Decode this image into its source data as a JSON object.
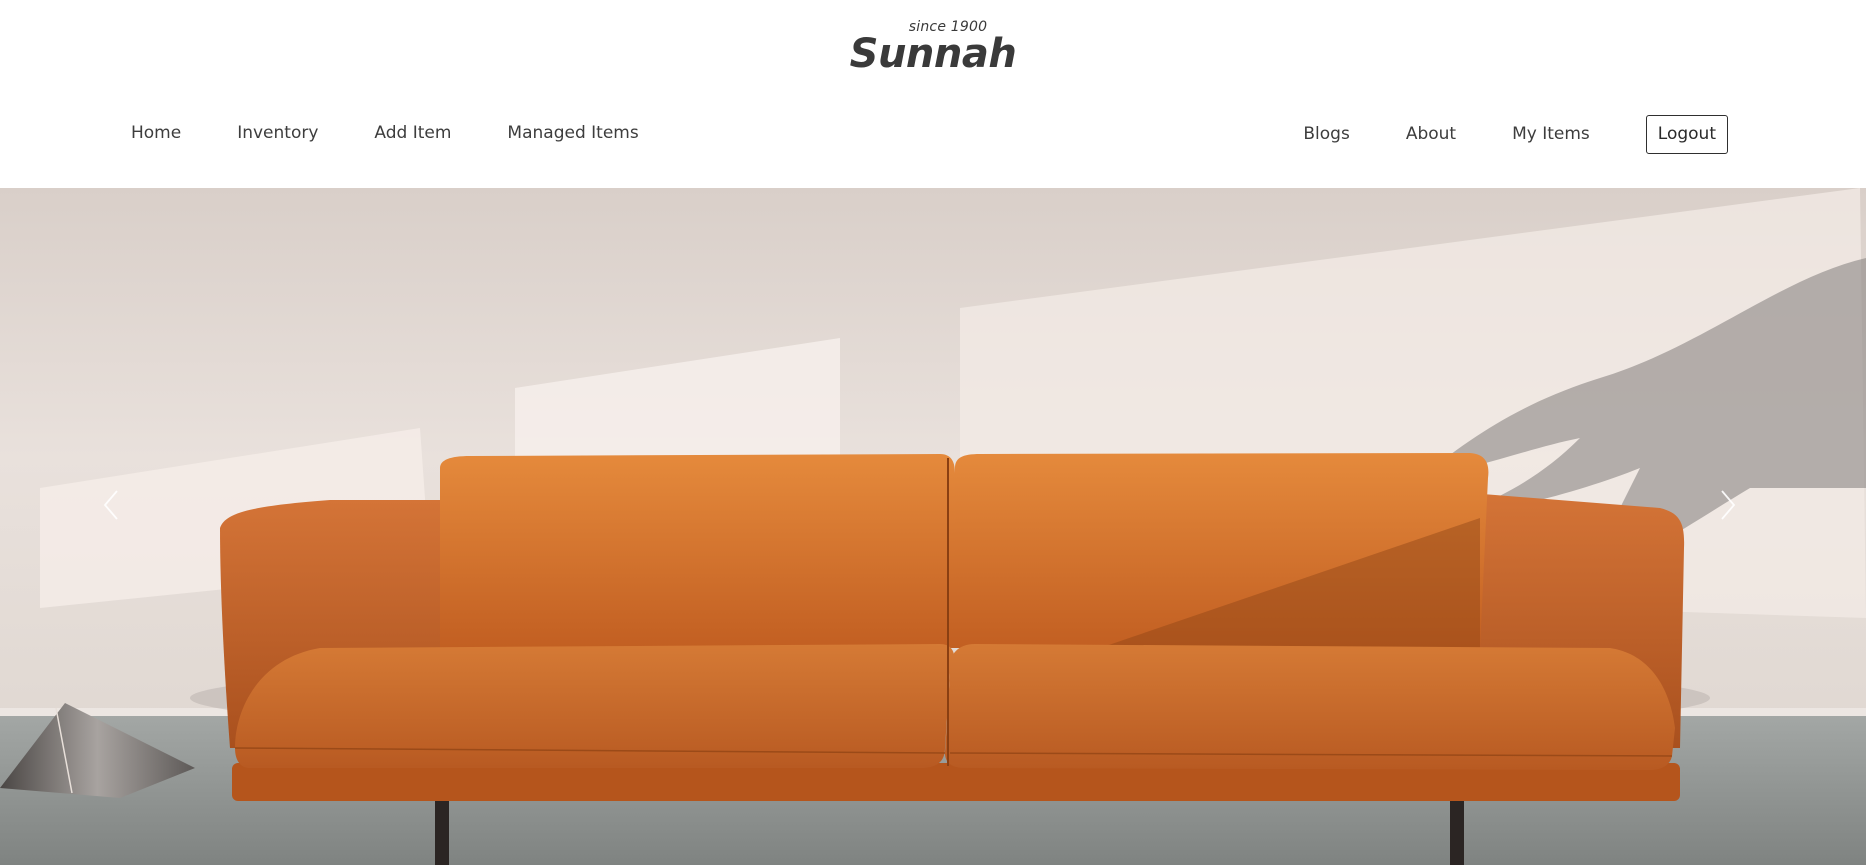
{
  "brand": {
    "tagline": "since 1900",
    "name": "Sunnah"
  },
  "nav": {
    "left": [
      {
        "label": "Home"
      },
      {
        "label": "Inventory"
      },
      {
        "label": "Add Item"
      },
      {
        "label": "Managed Items"
      }
    ],
    "right": [
      {
        "label": "Blogs"
      },
      {
        "label": "About"
      },
      {
        "label": "My Items"
      }
    ],
    "logout_label": "Logout"
  },
  "carousel": {
    "slide_subject": "orange leather sofa in sunlit room",
    "prev_icon": "chevron-left-icon",
    "next_icon": "chevron-right-icon"
  },
  "colors": {
    "text": "#3d3d3d",
    "sofa": "#c5672a",
    "wall": "#e8dfda",
    "floor": "#8f9290"
  }
}
